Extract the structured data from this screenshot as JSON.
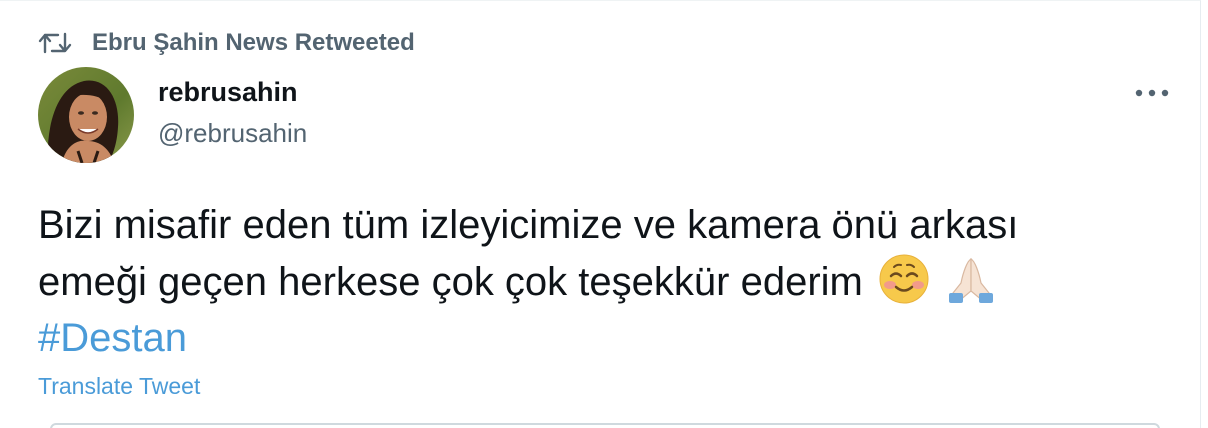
{
  "retweet": {
    "icon": "retweet-icon",
    "text": "Ebru Şahin News Retweeted"
  },
  "tweet": {
    "author": {
      "display_name": "rebrusahin",
      "handle": "@rebrusahin",
      "avatar": "avatar-photo"
    },
    "more_icon": "more-horizontal-icon",
    "text_line_1": "Bizi misafir eden tüm izleyicimize ve kamera önü arkası",
    "text_line_2": "emeği geçen herkese çok çok teşekkür ederim",
    "emojis": [
      "smiling-face-with-blush-emoji",
      "folded-hands-emoji"
    ],
    "hashtag": "#Destan",
    "translate_label": "Translate Tweet"
  },
  "colors": {
    "text_primary": "#0f1419",
    "text_secondary": "#536471",
    "link": "#4a9bd8"
  }
}
